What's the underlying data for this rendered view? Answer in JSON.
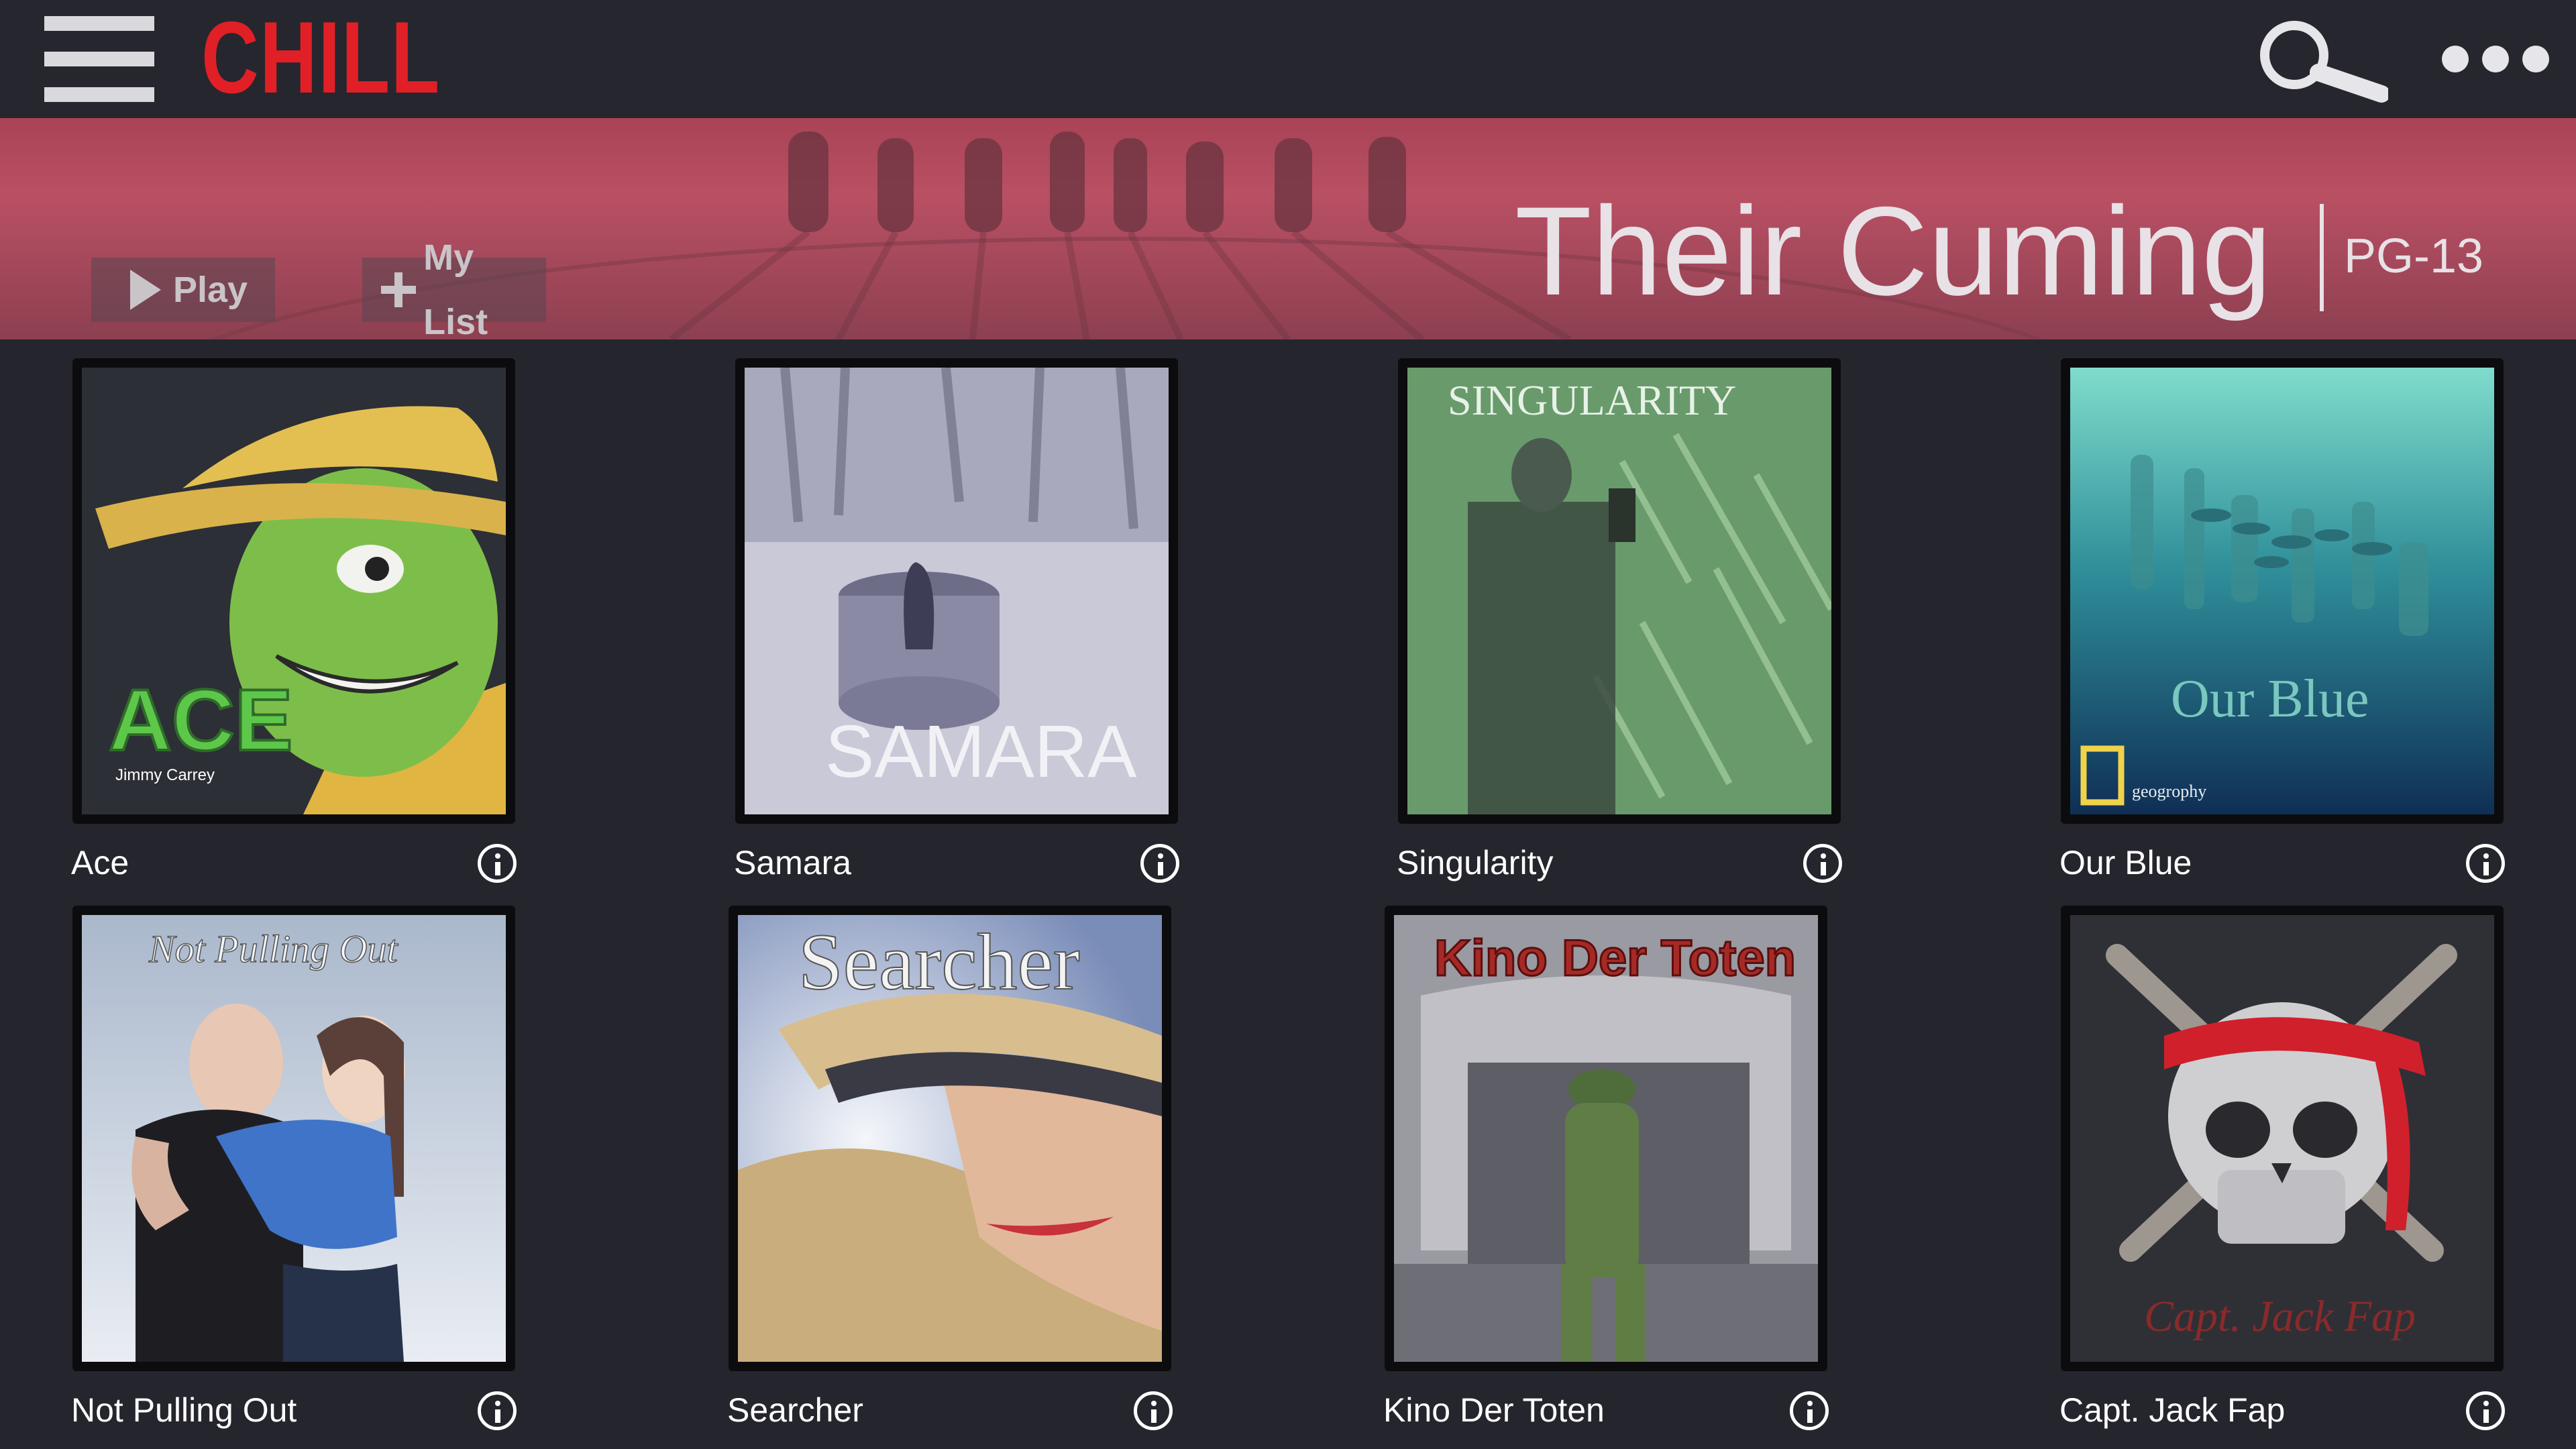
{
  "app": {
    "logo": "CHILL"
  },
  "header": {
    "menu_icon": "hamburger-menu-icon",
    "search_icon": "search-icon",
    "more_icon": "more-options-icon"
  },
  "hero": {
    "title": "Their Cuming",
    "rating": "PG-13",
    "play_label": "Play",
    "mylist_label": "My List"
  },
  "titles": [
    {
      "name": "Ace",
      "poster_text": "ACE",
      "poster_subtext": "Jimmy Carrey"
    },
    {
      "name": "Samara",
      "poster_text": "SAMARA"
    },
    {
      "name": "Singularity",
      "poster_text": "SINGULARITY"
    },
    {
      "name": "Our Blue",
      "poster_text": "Our Blue",
      "poster_subtext": "geogrophy"
    },
    {
      "name": "Not Pulling Out",
      "poster_text": "Not Pulling Out"
    },
    {
      "name": "Searcher",
      "poster_text": "Searcher"
    },
    {
      "name": "Kino Der Toten",
      "poster_text": "Kino Der Toten"
    },
    {
      "name": "Capt. Jack Fap",
      "poster_text": "Capt. Jack Fap"
    }
  ],
  "colors": {
    "brand": "#e11f26",
    "background": "#25252d",
    "hero": "#b04a5e"
  }
}
